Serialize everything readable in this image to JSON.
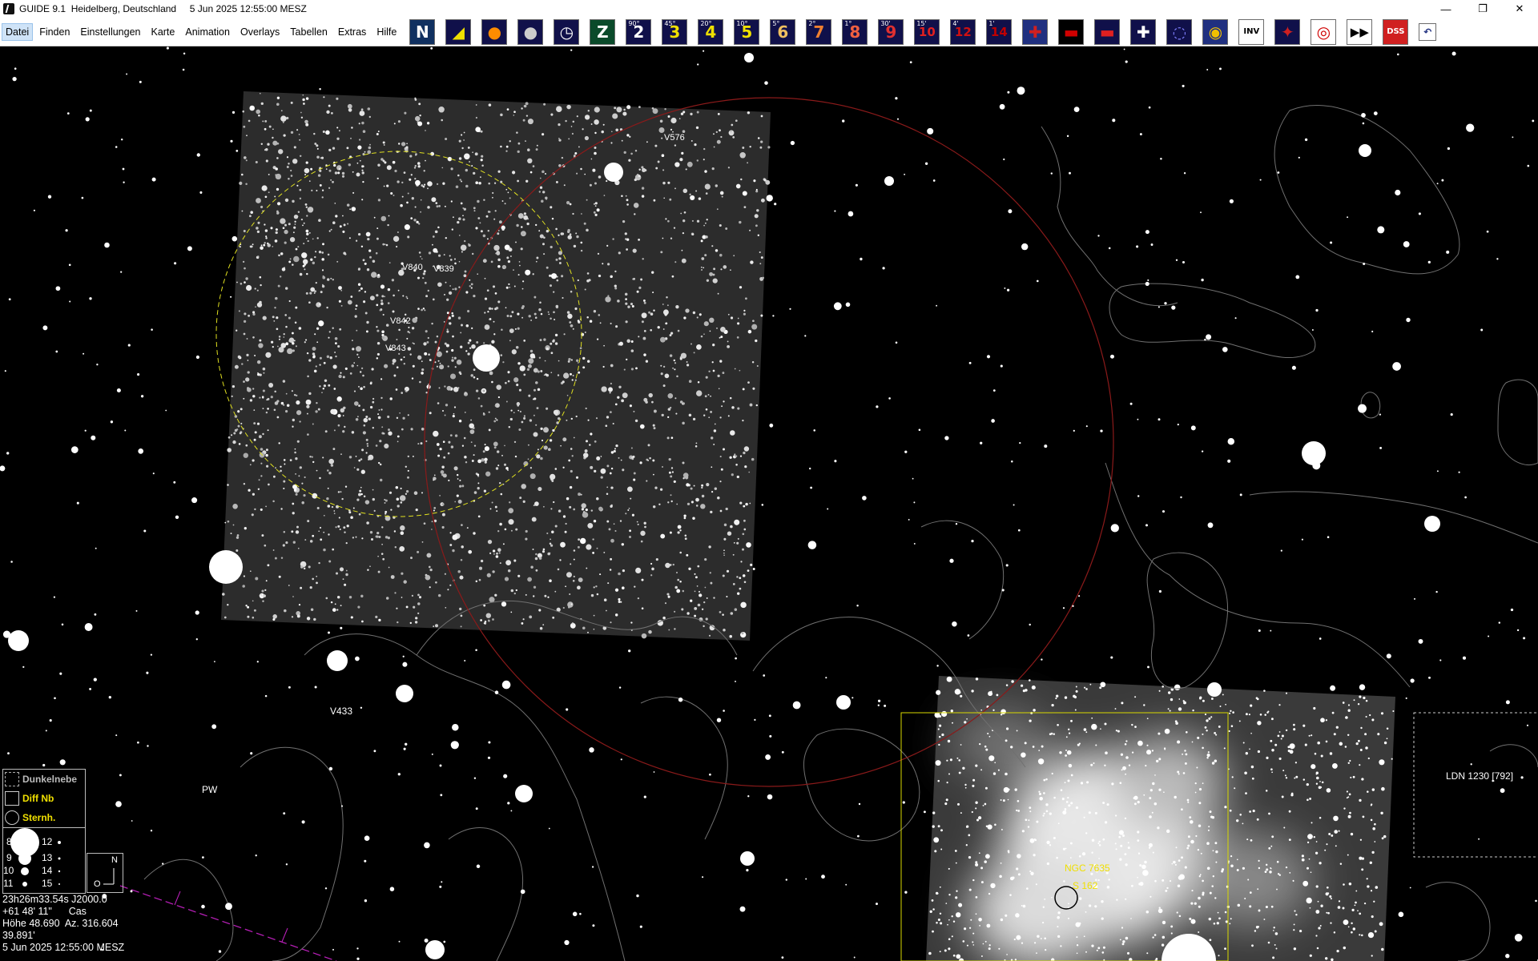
{
  "window": {
    "title": "GUIDE 9.1  Heidelberg, Deutschland     5 Jun 2025 12:55:00 MESZ",
    "minimize": "—",
    "restore": "❐",
    "close": "✕"
  },
  "menu": [
    {
      "label": "Datei",
      "selected": true
    },
    {
      "label": "Finden"
    },
    {
      "label": "Einstellungen"
    },
    {
      "label": "Karte"
    },
    {
      "label": "Animation"
    },
    {
      "label": "Overlays"
    },
    {
      "label": "Tabellen"
    },
    {
      "label": "Extras"
    },
    {
      "label": "Hilfe"
    }
  ],
  "toolbar": [
    {
      "icon": "north-up-icon",
      "text": "N",
      "sup": "",
      "fg": "#ffffff",
      "bg": "#103060"
    },
    {
      "icon": "ecliptic-icon",
      "text": "◢",
      "sup": "",
      "fg": "#f0e000",
      "bg": "#10104a"
    },
    {
      "icon": "sun-icon",
      "text": "●",
      "sup": "",
      "fg": "#ff8c00",
      "bg": "#10104a"
    },
    {
      "icon": "moon-icon",
      "text": "●",
      "sup": "",
      "fg": "#cccccc",
      "bg": "#10104a"
    },
    {
      "icon": "clock-icon",
      "text": "◷",
      "sup": "",
      "fg": "#ffffff",
      "bg": "#10104a"
    },
    {
      "icon": "zenith-icon",
      "text": "Z",
      "sup": "",
      "fg": "#ffffff",
      "bg": "#0a4a2a"
    },
    {
      "icon": "zoom-level-2-icon",
      "text": "2",
      "sup": "90°",
      "fg": "#ffffff",
      "bg": "#10104a"
    },
    {
      "icon": "zoom-level-3-icon",
      "text": "3",
      "sup": "45°",
      "fg": "#f0e000",
      "bg": "#10104a"
    },
    {
      "icon": "zoom-level-4-icon",
      "text": "4",
      "sup": "20°",
      "fg": "#f0e000",
      "bg": "#10104a"
    },
    {
      "icon": "zoom-level-5-icon",
      "text": "5",
      "sup": "10°",
      "fg": "#f0e000",
      "bg": "#10104a"
    },
    {
      "icon": "zoom-level-6-icon",
      "text": "6",
      "sup": "5°",
      "fg": "#f0c060",
      "bg": "#10104a"
    },
    {
      "icon": "zoom-level-7-icon",
      "text": "7",
      "sup": "2°",
      "fg": "#f08030",
      "bg": "#10104a"
    },
    {
      "icon": "zoom-level-8-icon",
      "text": "8",
      "sup": "1°",
      "fg": "#f06040",
      "bg": "#10104a"
    },
    {
      "icon": "zoom-level-9-icon",
      "text": "9",
      "sup": "30'",
      "fg": "#e03030",
      "bg": "#10104a"
    },
    {
      "icon": "zoom-level-10-icon",
      "text": "10",
      "sup": "15'",
      "fg": "#e02020",
      "bg": "#10104a"
    },
    {
      "icon": "zoom-level-12-icon",
      "text": "12",
      "sup": "4'",
      "fg": "#d01010",
      "bg": "#10104a"
    },
    {
      "icon": "zoom-level-14-icon",
      "text": "14",
      "sup": "1'",
      "fg": "#c00000",
      "bg": "#10104a"
    },
    {
      "icon": "language-english-icon",
      "text": "✚",
      "sup": "",
      "fg": "#d02020",
      "bg": "#203080"
    },
    {
      "icon": "language-german-icon",
      "text": "▬",
      "sup": "",
      "fg": "#d00000",
      "bg": "#000000"
    },
    {
      "icon": "star-chart-red-icon",
      "text": "▬",
      "sup": "",
      "fg": "#e02020",
      "bg": "#10104a"
    },
    {
      "icon": "crosshair-icon",
      "text": "✚",
      "sup": "",
      "fg": "#ffffff",
      "bg": "#10104a"
    },
    {
      "icon": "galaxy-icon",
      "text": "◌",
      "sup": "",
      "fg": "#8080ff",
      "bg": "#10104a"
    },
    {
      "icon": "globe-icon",
      "text": "◉",
      "sup": "",
      "fg": "#f0c000",
      "bg": "#203080"
    },
    {
      "icon": "inverse-icon",
      "text": "INV",
      "sup": "",
      "fg": "#000000",
      "bg": "#ffffff"
    },
    {
      "icon": "deep-sky-icon",
      "text": "✦",
      "sup": "",
      "fg": "#d02020",
      "bg": "#10104a"
    },
    {
      "icon": "target-icon",
      "text": "◎",
      "sup": "",
      "fg": "#d00000",
      "bg": "#ffffff"
    },
    {
      "icon": "fast-forward-icon",
      "text": "▶▶",
      "sup": "",
      "fg": "#000000",
      "bg": "#ffffff"
    },
    {
      "icon": "dss-icon",
      "text": "DSS",
      "sup": "",
      "fg": "#ffffff",
      "bg": "#d02020"
    },
    {
      "icon": "undo-icon",
      "text": "↶",
      "sup": "",
      "fg": "#203080",
      "bg": "#ffffff"
    }
  ],
  "labels": {
    "v576": "V576",
    "v840": "V840",
    "v839": "V839",
    "v842": "V842",
    "v843": "V843",
    "v433": "V433",
    "pw": "PW",
    "ngc7635": "NGC 7635",
    "s162": "S 162",
    "ldn1230": "LDN 1230 [792]"
  },
  "legend": {
    "dark_nebula": "Dunkelnebe",
    "diff_nb": "Diff Nb",
    "star_cluster": "Sternh.",
    "mags_left": [
      "8",
      "9",
      "10",
      "11"
    ],
    "mags_right": [
      "12",
      "13",
      "14",
      "15"
    ],
    "compass_n": "N",
    "compass_o": "O"
  },
  "status": {
    "ra": "23h26m33.54s J2000.0",
    "dec": "+61 48' 11\"      Cas",
    "altaz": "Höhe 48.690  Az. 316.604",
    "fov": "39.891'",
    "datetime": "5 Jun 2025 12:55:00 MESZ"
  },
  "colors": {
    "cluster_circle": "#e0e020",
    "red_circle": "#8a1a1a",
    "contours": "#707070",
    "survey_frame": "#d8d800",
    "ecliptic_line": "#c020c0"
  }
}
